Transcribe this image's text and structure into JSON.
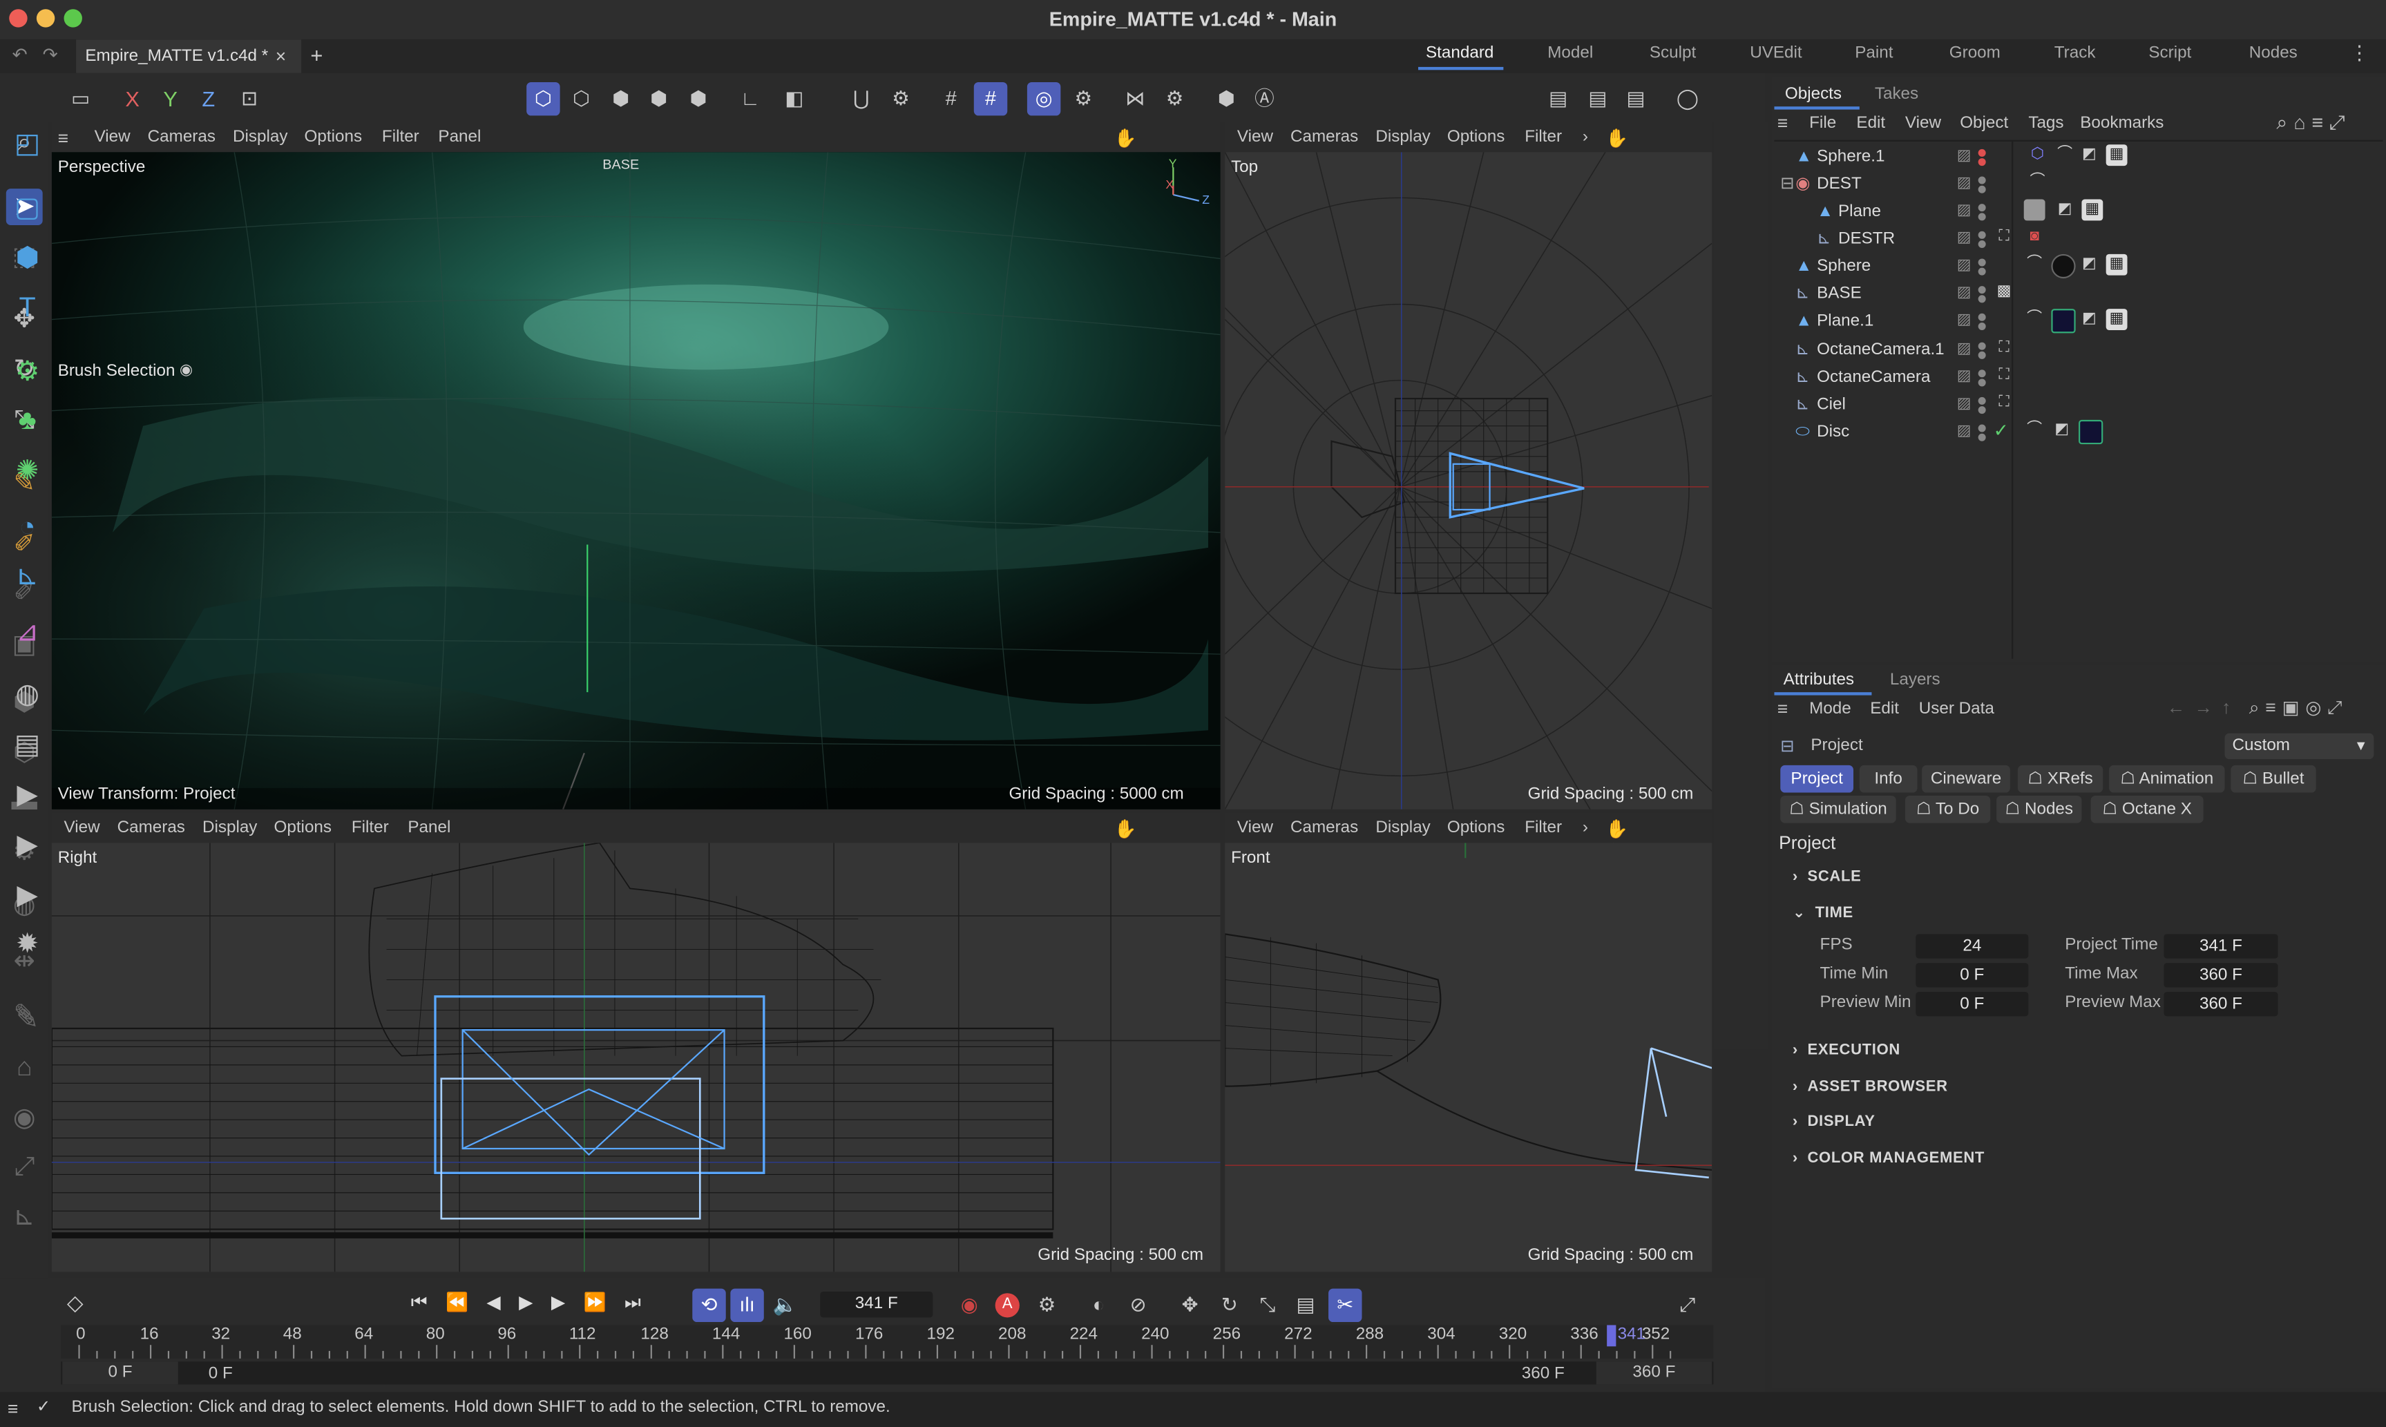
{
  "window": {
    "title": "Empire_MATTE v1.c4d * - Main"
  },
  "doc_tab": {
    "label": "Empire_MATTE v1.c4d *",
    "close": "×",
    "add": "+"
  },
  "layouts": [
    "Standard",
    "Model",
    "Sculpt",
    "UVEdit",
    "Paint",
    "Groom",
    "Track",
    "Script",
    "Nodes"
  ],
  "axis_toggles": [
    "X",
    "Y",
    "Z"
  ],
  "viewport_menu": [
    "View",
    "Cameras",
    "Display",
    "Options",
    "Filter",
    "Panel"
  ],
  "viewports": {
    "perspective": {
      "label": "Perspective",
      "grid": "Grid Spacing : 5000 cm",
      "brush": "Brush Selection",
      "transform": "View Transform: Project",
      "base_tag": "BASE"
    },
    "top": {
      "label": "Top",
      "grid": "Grid Spacing : 500 cm"
    },
    "right": {
      "label": "Right",
      "grid": "Grid Spacing : 500 cm"
    },
    "front": {
      "label": "Front",
      "grid": "Grid Spacing : 500 cm"
    }
  },
  "objects_panel": {
    "tabs": [
      "Objects",
      "Takes"
    ],
    "menu": [
      "File",
      "Edit",
      "View",
      "Object",
      "Tags",
      "Bookmarks"
    ],
    "rows": [
      {
        "name": "Sphere.1",
        "indent": 0
      },
      {
        "name": "DEST",
        "indent": 0
      },
      {
        "name": "Plane",
        "indent": 1
      },
      {
        "name": "DESTR",
        "indent": 1
      },
      {
        "name": "Sphere",
        "indent": 0
      },
      {
        "name": "BASE",
        "indent": 0
      },
      {
        "name": "Plane.1",
        "indent": 0
      },
      {
        "name": "OctaneCamera.1",
        "indent": 0
      },
      {
        "name": "OctaneCamera",
        "indent": 0
      },
      {
        "name": "Ciel",
        "indent": 0
      },
      {
        "name": "Disc",
        "indent": 0
      }
    ]
  },
  "attributes": {
    "tabs": [
      "Attributes",
      "Layers"
    ],
    "menu": [
      "Mode",
      "Edit",
      "User Data"
    ],
    "object_label": "Project",
    "preset": "Custom",
    "buttons_row1": [
      "Project",
      "Info",
      "Cineware",
      "XRefs",
      "Animation",
      "Bullet"
    ],
    "buttons_row2": [
      "Simulation",
      "To Do",
      "Nodes",
      "Octane X"
    ],
    "heading": "Project",
    "sections": [
      "SCALE",
      "TIME",
      "EXECUTION",
      "ASSET BROWSER",
      "DISPLAY",
      "COLOR MANAGEMENT"
    ],
    "time": {
      "fps_label": "FPS",
      "fps": "24",
      "project_time_label": "Project Time",
      "project_time": "341 F",
      "time_min_label": "Time Min",
      "time_min": "0 F",
      "time_max_label": "Time Max",
      "time_max": "360 F",
      "preview_min_label": "Preview Min",
      "preview_min": "0 F",
      "preview_max_label": "Preview Max",
      "preview_max": "360 F"
    }
  },
  "timeline": {
    "current_frame": "341 F",
    "ticks": [
      "0",
      "16",
      "32",
      "48",
      "64",
      "80",
      "96",
      "112",
      "128",
      "144",
      "160",
      "176",
      "192",
      "208",
      "224",
      "240",
      "256",
      "272",
      "288",
      "304",
      "320",
      "336",
      "352"
    ],
    "playhead_label": "341",
    "range_start_a": "0 F",
    "range_start_b": "0 F",
    "range_end_a": "360 F",
    "range_end_b": "360 F"
  },
  "status": {
    "text": "Brush Selection: Click and drag to select elements. Hold down SHIFT to add to the selection, CTRL to remove."
  },
  "colors": {
    "accent": "#4f5fb8",
    "selection": "#5aa8ff",
    "teal": "#1f6f5a"
  }
}
